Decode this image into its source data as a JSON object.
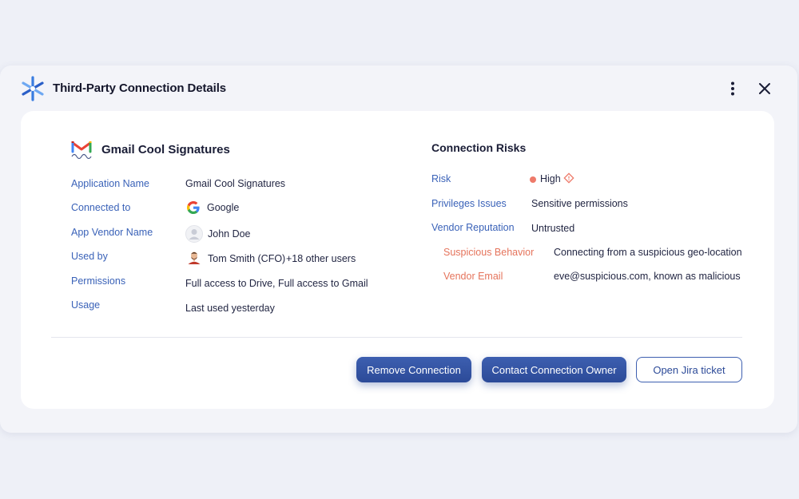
{
  "window": {
    "title": "Third-Party Connection Details"
  },
  "app": {
    "name": "Gmail Cool Signatures",
    "icon": "gmail-icon"
  },
  "details": [
    {
      "label": "Application Name",
      "value": "Gmail Cool Signatures",
      "icon": null
    },
    {
      "label": "Connected to",
      "value": "Google",
      "icon": "google-icon"
    },
    {
      "label": "App Vendor Name",
      "value": "John Doe",
      "icon": "avatar-placeholder-icon"
    },
    {
      "label": "Used by",
      "value": "Tom Smith (CFO)",
      "extra": "+18 other users",
      "icon": "user-avatar"
    },
    {
      "label": "Permissions",
      "value": "Full access to Drive, Full access to Gmail",
      "icon": null
    },
    {
      "label": "Usage",
      "value": "Last used yesterday",
      "icon": null
    }
  ],
  "risks": {
    "title": "Connection Risks",
    "items": [
      {
        "label": "Risk",
        "value": "High",
        "status_color": "#ee7a6a",
        "icon": "warning-diamond-icon"
      },
      {
        "label": "Privileges Issues",
        "value": "Sensitive permissions"
      },
      {
        "label": "Vendor Reputation",
        "value": "Untrusted"
      }
    ],
    "sub_items": [
      {
        "label": "Suspicious Behavior",
        "value": "Connecting from a suspicious geo-location"
      },
      {
        "label": "Vendor Email",
        "value": "eve@suspicious.com, known as malicious"
      }
    ]
  },
  "actions": {
    "remove": "Remove Connection",
    "contact": "Contact Connection Owner",
    "jira": "Open Jira ticket"
  },
  "colors": {
    "accent": "#3d5fb0",
    "label": "#3a62b8",
    "warning": "#e5745c",
    "background": "#eef0f7"
  }
}
